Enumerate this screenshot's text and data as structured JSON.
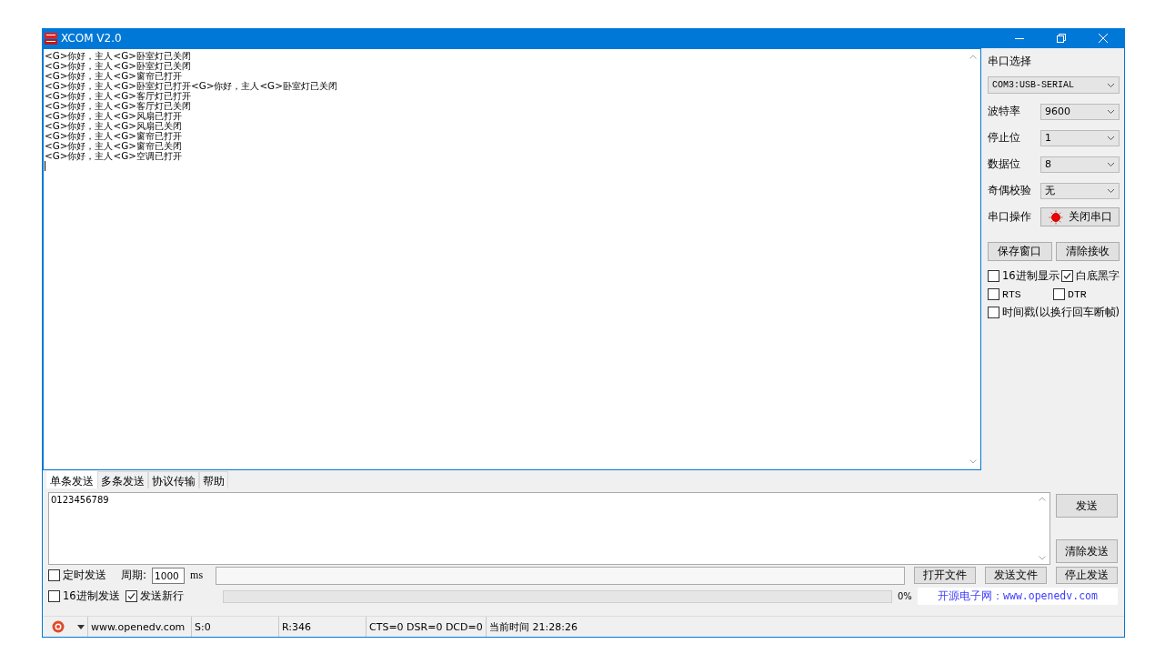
{
  "window": {
    "title": "XCOM V2.0"
  },
  "receive_log": [
    "<G>你好，主人<G>卧室灯已关闭",
    "<G>你好，主人<G>卧室灯已关闭",
    "<G>你好，主人<G>窗帘已打开",
    "<G>你好，主人<G>卧室灯已打开<G>你好，主人<G>卧室灯已关闭",
    "<G>你好，主人<G>客厅灯已打开",
    "<G>你好，主人<G>客厅灯已关闭",
    "<G>你好，主人<G>风扇已打开",
    "<G>你好，主人<G>风扇已关闭",
    "<G>你好，主人<G>窗帘已打开",
    "<G>你好，主人<G>窗帘已关闭",
    "<G>你好，主人<G>空调已打开"
  ],
  "settings": {
    "port_label": "串口选择",
    "port": "COM3:USB-SERIAL",
    "fields": [
      {
        "label": "波特率",
        "value": "9600"
      },
      {
        "label": "停止位",
        "value": "1"
      },
      {
        "label": "数据位",
        "value": "8"
      },
      {
        "label": "奇偶校验",
        "value": "无"
      }
    ],
    "operation_label": "串口操作",
    "operation_button": "关闭串口",
    "port_open": true,
    "buttons": [
      "保存窗口",
      "清除接收"
    ],
    "options": [
      {
        "label": "16进制显示",
        "checked": false
      },
      {
        "label": "白底黑字",
        "checked": true
      },
      {
        "label": "RTS",
        "checked": false
      },
      {
        "label": "DTR",
        "checked": false
      },
      {
        "label": "时间戳(以换行回车断帧)",
        "checked": false
      }
    ]
  },
  "tabs": [
    {
      "label": "单条发送",
      "selected": true
    },
    {
      "label": "多条发送",
      "selected": false
    },
    {
      "label": "协议传输",
      "selected": false
    },
    {
      "label": "帮助",
      "selected": false
    }
  ],
  "send": {
    "value": "0123456789",
    "send_button": "发送",
    "clear_button": "清除发送",
    "timed_send": {
      "label": "定时发送",
      "checked": false
    },
    "period_label": "周期:",
    "period": "1000",
    "period_unit": "ms",
    "hex_send": {
      "label": "16进制发送",
      "checked": false
    },
    "newline": {
      "label": "发送新行",
      "checked": true
    },
    "file_buttons": [
      "打开文件",
      "发送文件",
      "停止发送"
    ],
    "progress": {
      "level": 0,
      "reading": "0%"
    },
    "banner": "开源电子网：www.openedv.com"
  },
  "status_bar": {
    "website": "www.openedv.com",
    "sent": "S:0",
    "received": "R:346",
    "lines": "CTS=0 DSR=0 DCD=0",
    "time": "当前时间 21:28:26"
  }
}
